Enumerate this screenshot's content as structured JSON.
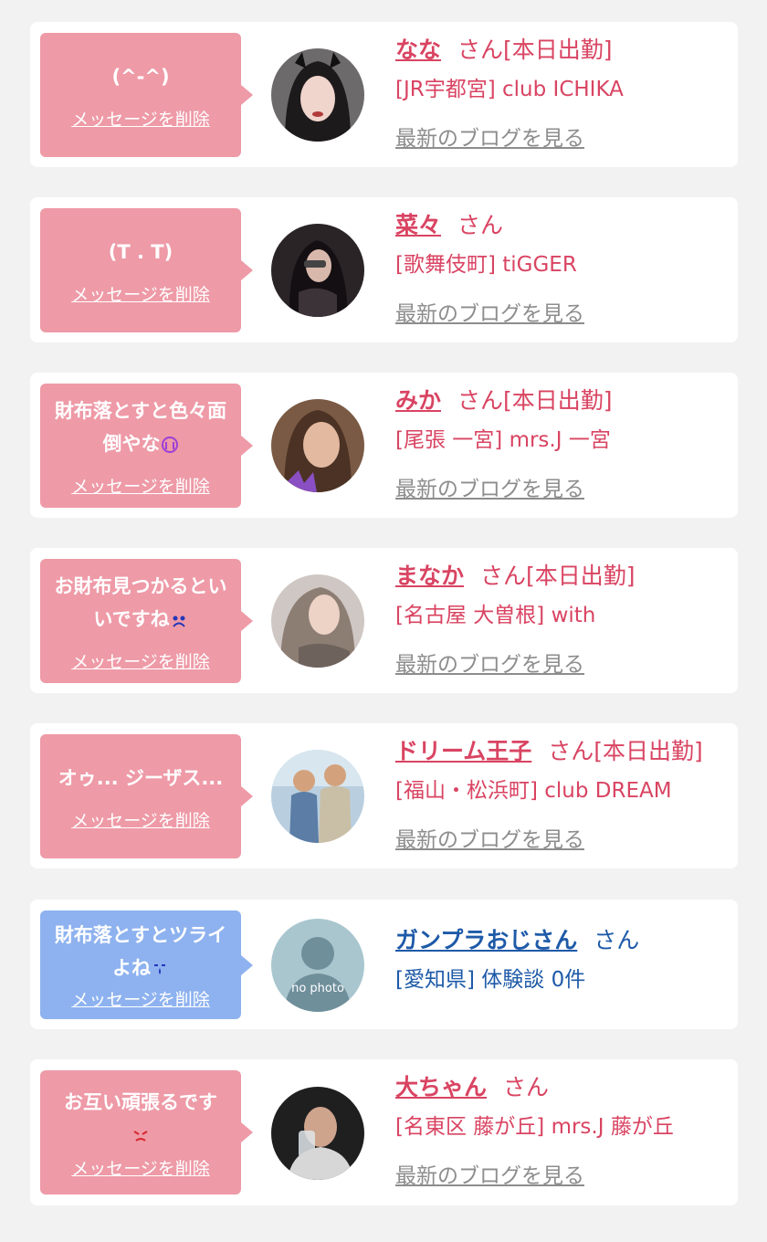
{
  "delete_label": "メッセージを削除",
  "blog_label": "最新のブログを見る",
  "honorific": "さん",
  "colors": {
    "pink_bubble": "#ee9aa7",
    "blue_bubble": "#8eb2ef",
    "pink_text": "#d94462",
    "blue_text": "#1e5aa8",
    "link_gray": "#8d8d8d"
  },
  "cards": [
    {
      "message": "(^-^)",
      "message_emoji": "",
      "name": "なな",
      "status": "[本日出勤]",
      "shop": "[JR宇都宮] club ICHIKA",
      "type": "cast"
    },
    {
      "message": "(T . T)",
      "message_emoji": "",
      "name": "菜々",
      "status": "",
      "shop": "[歌舞伎町] tiGGER",
      "type": "cast"
    },
    {
      "message": "財布落とすと色々面倒やな",
      "message_emoji": "crying-face-icon",
      "name": "みか",
      "status": "[本日出勤]",
      "shop": "[尾張 一宮] mrs.J 一宮",
      "type": "cast"
    },
    {
      "message": "お財布見つかるといいですね",
      "message_emoji": "sad-face-icon",
      "name": "まなか",
      "status": "[本日出勤]",
      "shop": "[名古屋 大曽根] with",
      "type": "cast"
    },
    {
      "message": "オゥ... ジーザス...",
      "message_emoji": "",
      "name": "ドリーム王子",
      "status": "[本日出勤]",
      "shop": "[福山・松浜町]  club DREAM",
      "type": "cast"
    },
    {
      "message": "財布落とすとツライよね",
      "message_emoji": "tear-face-icon",
      "name": "ガンプラおじさん",
      "status": "",
      "shop": "[愛知県] 体験談 0件",
      "type": "member",
      "avatar_text": "no photo"
    },
    {
      "message": "お互い頑張るです",
      "message_emoji": "angry-face-icon",
      "name": "大ちゃん",
      "status": "",
      "shop": "[名東区 藤が丘] mrs.J 藤が丘",
      "type": "cast"
    }
  ]
}
